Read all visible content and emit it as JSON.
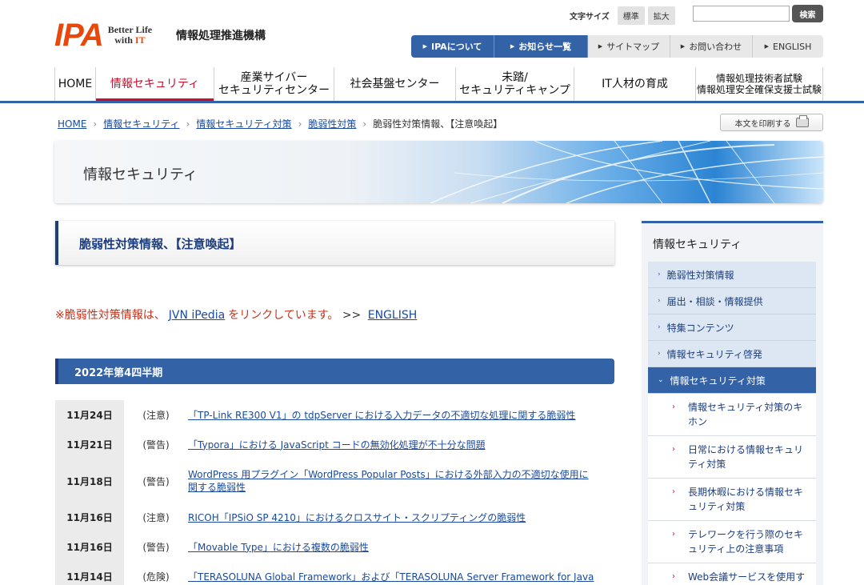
{
  "header": {
    "logo_mark": "IPA",
    "logo_tag_1": "Better Life",
    "logo_tag_2": "with",
    "logo_tag_3": "IT",
    "org_name": "情報処理推進機構",
    "font_size_label": "文字サイズ",
    "font_size_standard": "標準",
    "font_size_large": "拡大",
    "search_placeholder": "",
    "search_button": "検索"
  },
  "utility_nav": [
    {
      "label": "IPAについて"
    },
    {
      "label": "お知らせ一覧"
    },
    {
      "label": "サイトマップ"
    },
    {
      "label": "お問い合わせ"
    },
    {
      "label": "ENGLISH"
    }
  ],
  "global_nav": [
    {
      "label": "HOME"
    },
    {
      "label": "情報セキュリティ"
    },
    {
      "label_1": "産業サイバー",
      "label_2": "セキュリティセンター"
    },
    {
      "label": "社会基盤センター"
    },
    {
      "label_1": "未踏/",
      "label_2": "セキュリティキャンプ"
    },
    {
      "label": "IT人材の育成"
    },
    {
      "label_1": "情報処理技術者試験",
      "label_2": "情報処理安全確保支援士試験"
    }
  ],
  "breadcrumb": [
    "HOME",
    "情報セキュリティ",
    "情報セキュリティ対策",
    "脆弱性対策",
    "脆弱性対策情報、【注意喚起】"
  ],
  "print_button": "本文を印刷する",
  "banner_title": "情報セキュリティ",
  "page_title": "脆弱性対策情報、【注意喚起】",
  "notice": {
    "prefix": "※脆弱性対策情報は、",
    "link": "JVN iPedia",
    "suffix": "をリンクしています。",
    "arrows": ">>",
    "english": "ENGLISH"
  },
  "section_heading": "2022年第4四半期",
  "vulns": [
    {
      "date": "11月24日",
      "type": "(注意)",
      "title": "「TP-Link RE300 V1」の tdpServer における入力データの不適切な処理に関する脆弱性"
    },
    {
      "date": "11月21日",
      "type": "(警告)",
      "title": "「Typora」における JavaScript コードの無効化処理が不十分な問題"
    },
    {
      "date": "11月18日",
      "type": "(警告)",
      "title": "WordPress 用プラグイン「WordPress Popular Posts」における外部入力の不適切な使用に関する脆弱性"
    },
    {
      "date": "11月16日",
      "type": "(注意)",
      "title": "RICOH「IPSiO SP 4210」におけるクロスサイト・スクリプティングの脆弱性"
    },
    {
      "date": "11月16日",
      "type": "(警告)",
      "title": "「Movable Type」における複数の脆弱性"
    },
    {
      "date": "11月14日",
      "type": "(危険)",
      "title": "「TERASOLUNA Global Framework」および「TERASOLUNA Server Framework for Java"
    }
  ],
  "sidebar": {
    "heading": "情報セキュリティ",
    "items": [
      {
        "label": "脆弱性対策情報"
      },
      {
        "label": "届出・相談・情報提供"
      },
      {
        "label": "特集コンテンツ"
      },
      {
        "label": "情報セキュリティ啓発"
      },
      {
        "label": "情報セキュリティ対策"
      }
    ],
    "subitems": [
      {
        "label": "情報セキュリティ対策のキホン"
      },
      {
        "label": "日常における情報セキュリティ対策"
      },
      {
        "label": "長期休暇における情報セキュリティ対策"
      },
      {
        "label": "テレワークを行う際のセキュリティ上の注意事項"
      },
      {
        "label": "Web会議サービスを使用する際のセキュリティ上の注"
      }
    ]
  },
  "colors": {
    "brand_orange": "#e8480c",
    "nav_blue": "#3462a6",
    "accent_red": "#c8102e",
    "link_blue": "#1a4a9c"
  }
}
